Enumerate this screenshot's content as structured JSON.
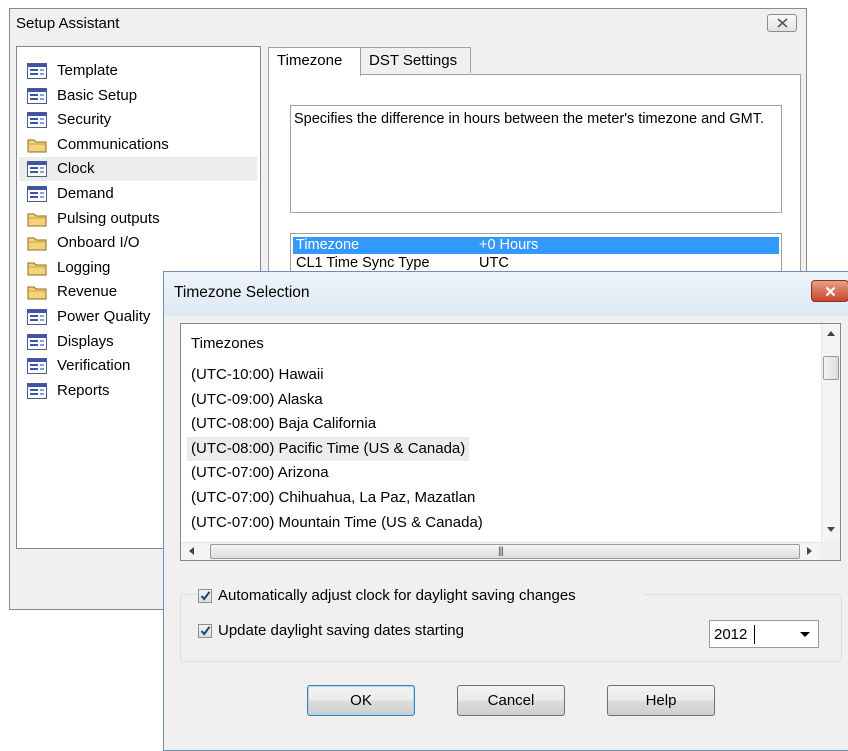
{
  "setup": {
    "title": "Setup Assistant",
    "tree_items": [
      {
        "label": "Template",
        "icon": "form-icon"
      },
      {
        "label": "Basic Setup",
        "icon": "form-icon"
      },
      {
        "label": "Security",
        "icon": "form-icon"
      },
      {
        "label": "Communications",
        "icon": "folder-icon"
      },
      {
        "label": "Clock",
        "icon": "form-icon",
        "selected": true
      },
      {
        "label": "Demand",
        "icon": "form-icon"
      },
      {
        "label": "Pulsing outputs",
        "icon": "folder-icon"
      },
      {
        "label": "Onboard I/O",
        "icon": "folder-icon"
      },
      {
        "label": "Logging",
        "icon": "folder-icon"
      },
      {
        "label": "Revenue",
        "icon": "folder-icon"
      },
      {
        "label": "Power Quality",
        "icon": "form-icon"
      },
      {
        "label": "Displays",
        "icon": "form-icon"
      },
      {
        "label": "Verification",
        "icon": "form-icon"
      },
      {
        "label": "Reports",
        "icon": "form-icon"
      }
    ],
    "tabs": [
      {
        "label": "Timezone",
        "active": true
      },
      {
        "label": "DST Settings",
        "active": false
      }
    ],
    "description": "Specifies the difference in hours between the meter's timezone and GMT.",
    "properties": [
      {
        "name": "Timezone",
        "value": "+0 Hours",
        "selected": true
      },
      {
        "name": "CL1 Time Sync Type",
        "value": "UTC",
        "selected": false
      }
    ]
  },
  "tz_dialog": {
    "title": "Timezone Selection",
    "list_header": "Timezones",
    "timezones": [
      "(UTC-10:00) Hawaii",
      "(UTC-09:00) Alaska",
      "(UTC-08:00) Baja California",
      "(UTC-08:00) Pacific Time (US & Canada)",
      "(UTC-07:00) Arizona",
      "(UTC-07:00) Chihuahua, La Paz, Mazatlan",
      "(UTC-07:00) Mountain Time (US & Canada)"
    ],
    "highlighted_index": 3,
    "auto_adjust_label": "Automatically adjust clock for daylight saving changes",
    "auto_adjust_checked": true,
    "update_dates_label": "Update daylight saving dates starting",
    "update_dates_checked": true,
    "year": "2012",
    "ok_label": "OK",
    "cancel_label": "Cancel",
    "help_label": "Help",
    "close_color": "#c8452c",
    "selection_color": "#3399ff"
  }
}
